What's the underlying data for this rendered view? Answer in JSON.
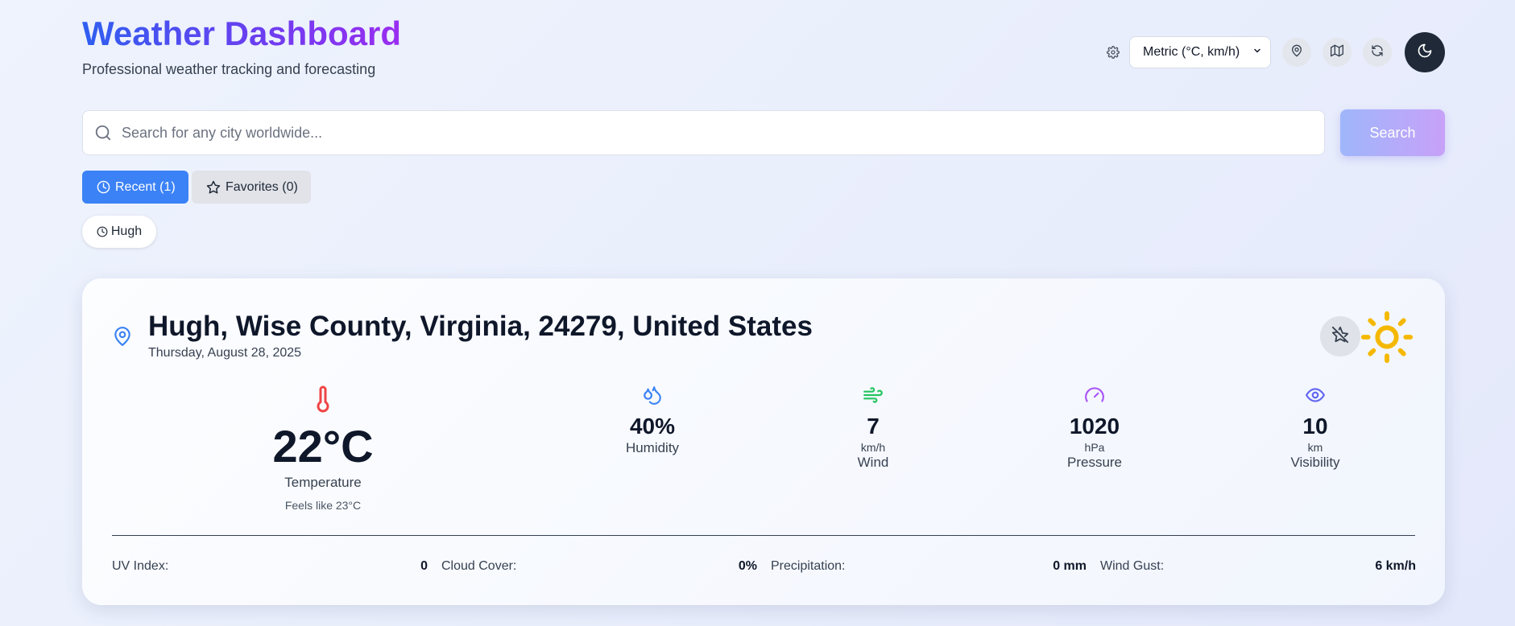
{
  "header": {
    "title": "Weather Dashboard",
    "subtitle": "Professional weather tracking and forecasting",
    "units_selected": "Metric (°C, km/h)"
  },
  "search": {
    "placeholder": "Search for any city worldwide...",
    "button_label": "Search"
  },
  "tabs": {
    "recent_label": "Recent (1)",
    "favorites_label": "Favorites (0)"
  },
  "recent_items": [
    {
      "label": "Hugh"
    }
  ],
  "location": {
    "name": "Hugh, Wise County, Virginia, 24279, United States",
    "date": "Thursday, August 28, 2025"
  },
  "temperature": {
    "value": "22°C",
    "label": "Temperature",
    "feels_like": "Feels like 23°C"
  },
  "metrics": {
    "humidity": {
      "value": "40%",
      "label": "Humidity"
    },
    "wind": {
      "value": "7",
      "unit": "km/h",
      "label": "Wind"
    },
    "pressure": {
      "value": "1020",
      "unit": "hPa",
      "label": "Pressure"
    },
    "visibility": {
      "value": "10",
      "unit": "km",
      "label": "Visibility"
    }
  },
  "details": {
    "uv": {
      "label": "UV Index:",
      "value": "0"
    },
    "cloud": {
      "label": "Cloud Cover:",
      "value": "0%"
    },
    "precip": {
      "label": "Precipitation:",
      "value": "0 mm"
    },
    "gust": {
      "label": "Wind Gust:",
      "value": "6 km/h"
    }
  },
  "colors": {
    "accent_blue": "#3b82f6",
    "temp_red": "#ef4444",
    "humidity_blue": "#3b82f6",
    "wind_green": "#22c55e",
    "pressure_purple": "#a855f7",
    "visibility_indigo": "#6366f1",
    "sun_yellow": "#f5b800"
  },
  "icons": [
    "settings-icon",
    "location-pin-icon",
    "map-icon",
    "refresh-icon",
    "moon-icon",
    "search-icon",
    "clock-icon",
    "star-icon",
    "star-off-icon",
    "sun-icon",
    "thermometer-icon",
    "droplets-icon",
    "wind-icon",
    "gauge-icon",
    "eye-icon"
  ]
}
